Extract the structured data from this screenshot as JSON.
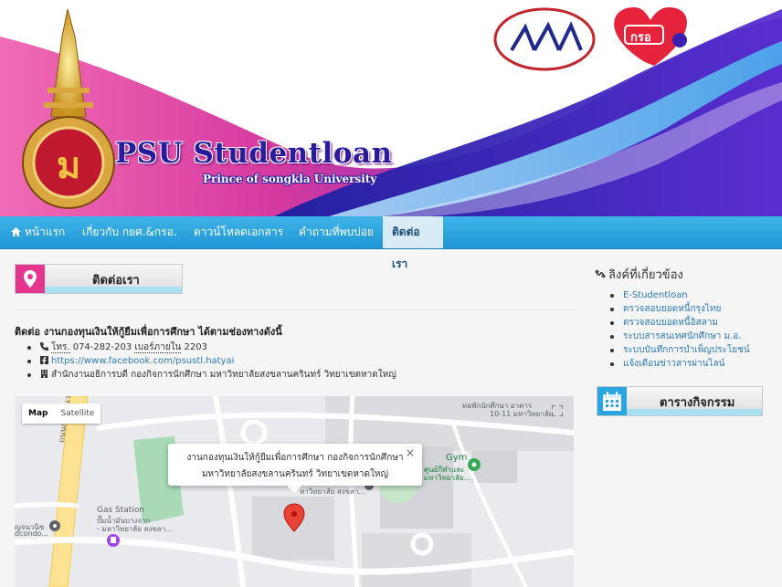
{
  "banner": {
    "title": "PSU Studentloan",
    "subtitle": "Prince of songkla University",
    "logo_right_text": "กรอ"
  },
  "nav": {
    "items": [
      {
        "label": "หน้าแรก"
      },
      {
        "label": "เกี่ยวกับ กยศ.&กรอ."
      },
      {
        "label": "ดาวน์โหลดเอกสาร"
      },
      {
        "label": "คำถามที่พบบ่อย"
      },
      {
        "label": "ติดต่อเรา"
      }
    ],
    "active_index": 4
  },
  "main": {
    "section_label": "ติดต่อเรา",
    "intro": "ติดต่อ งานกองทุนเงินให้กู้ยืมเพื่อการศึกษา ได้ตามช่องทางดังนี้",
    "phone_label": "โทร.",
    "phone": "074-282-203",
    "ext_label": "เบอร์ภายใน",
    "ext": "2203",
    "facebook": "https://www.facebook.com/psustl.hatyai",
    "address": "สำนักงานอธิการบดี กองกิจการนักศึกษา มหาวิทยาลัยสงขลานครินทร์ วิทยาเขตหาดใหญ่"
  },
  "map": {
    "type_map": "Map",
    "type_satellite": "Satellite",
    "info_line1": "งานกองทุนเงินให้กู้ยืมเพื่อการศึกษา กองกิจการนักศึกษา",
    "info_line2": "มหาวิทยาลัยสงขลานครินทร์ วิทยาเขตหาดใหญ่",
    "close": "×",
    "labels": {
      "gym": "Gym",
      "gym_sub1": "ศูนย์กีฬาและ",
      "gym_sub2": "มหาวิทยาลัย...",
      "gas": "Gas Station",
      "gas_sub1": "ปั๊มน้ำมันบางจาก",
      "gas_sub2": "- มหาวิทยาลัย สงขลา...",
      "road": "ถนนกาญจนวนิช",
      "top1": "หอพักนักศึกษา อาคาร",
      "top2": "10-11 มหาวิทยาลัย",
      "campus": "หาวิทยาลัย สงขลา...",
      "left1": "ญจนวนิช",
      "left2": "dcondo..."
    }
  },
  "sidebar": {
    "title": "ลิงค์ที่เกี่ยวข้อง",
    "links": [
      {
        "label": "E-Studentloan"
      },
      {
        "label": "ตรวจสอบยอดหนี้กรุงไทย"
      },
      {
        "label": "ตรวจสอบยอดหนี้อิสลาม"
      },
      {
        "label": "ระบบสารสนเทศนักศึกษา ม.อ."
      },
      {
        "label": "ระบบบันทึกการบำเพ็ญประโยชน์"
      },
      {
        "label": "แจ้งเตือนข่าวสารผ่านไลน์"
      }
    ],
    "calendar_label": "ตารางกิจกรรม"
  },
  "colors": {
    "nav_blue": "#2aa5e0",
    "banner_pink": "#e4358f",
    "banner_purple": "#3b1fb0",
    "link": "#2a7ab8"
  }
}
